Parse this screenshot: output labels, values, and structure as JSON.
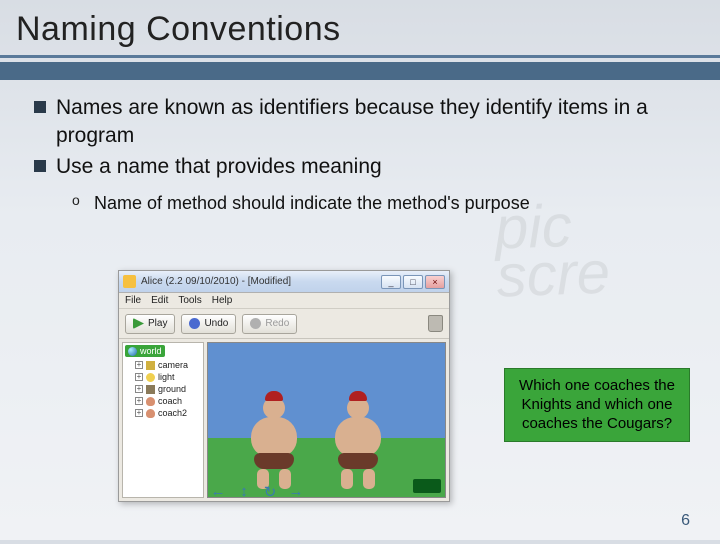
{
  "slide": {
    "title": "Naming Conventions",
    "bullets": [
      "Names are known as identifiers because they identify items in a program",
      "Use a name that provides meaning"
    ],
    "sub_bullets": [
      "Name of method should indicate the method's purpose"
    ],
    "page_number": "6"
  },
  "app_window": {
    "title": "Alice (2.2  09/10/2010) - [Modified]",
    "win_controls": {
      "min": "_",
      "max": "□",
      "close": "×"
    },
    "menu": [
      "File",
      "Edit",
      "Tools",
      "Help"
    ],
    "toolbar": {
      "play": "Play",
      "undo": "Undo",
      "redo": "Redo"
    },
    "tree": {
      "root": "world",
      "items": [
        {
          "label": "camera",
          "ico": "cam"
        },
        {
          "label": "light",
          "ico": "light"
        },
        {
          "label": "ground",
          "ico": "ground"
        },
        {
          "label": "coach",
          "ico": "coach"
        },
        {
          "label": "coach2",
          "ico": "coach"
        }
      ]
    }
  },
  "callout": {
    "text": "Which one coaches the Knights and which one coaches the Cougars?"
  }
}
